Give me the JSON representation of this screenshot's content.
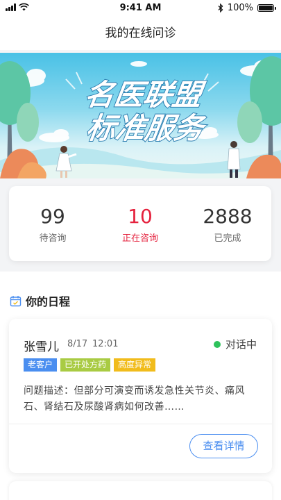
{
  "status_bar": {
    "time": "9:41 AM",
    "battery": "100%"
  },
  "nav": {
    "title": "我的在线问诊"
  },
  "banner": {
    "line1": "名医联盟",
    "line2": "标准服务"
  },
  "stats": [
    {
      "value": "99",
      "label": "待咨询"
    },
    {
      "value": "10",
      "label": "正在咨询"
    },
    {
      "value": "2888",
      "label": "已完成"
    }
  ],
  "schedule": {
    "title": "你的日程",
    "appointment": {
      "name": "张雪儿",
      "date": "8/17",
      "time": "12:01",
      "status": "对话中",
      "tags": [
        "老客户",
        "已开处方药",
        "高度异常"
      ],
      "description": "问题描述：但部分可演变而诱发急性关节炎、痛风石、肾结石及尿酸肾病如何改善……",
      "detail_button": "查看详情"
    }
  },
  "colors": {
    "accent": "#4a8ef0",
    "active": "#e5213d",
    "online": "#2ec25b"
  }
}
